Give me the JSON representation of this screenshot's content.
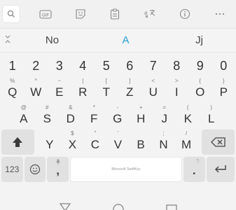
{
  "toolbar": {
    "items": [
      {
        "name": "search-icon"
      },
      {
        "name": "gif-icon",
        "label": "GIF"
      },
      {
        "name": "sticker-icon"
      },
      {
        "name": "clipboard-icon"
      },
      {
        "name": "translator-icon"
      },
      {
        "name": "info-icon"
      },
      {
        "name": "more-icon"
      }
    ]
  },
  "suggestions": {
    "collapse_icon": "chevrons-icon",
    "items": [
      "No",
      "A",
      "Jj"
    ]
  },
  "keyboard": {
    "numbers": [
      "1",
      "2",
      "3",
      "4",
      "5",
      "6",
      "7",
      "8",
      "9",
      "0"
    ],
    "row1": {
      "main": [
        "Q",
        "W",
        "E",
        "R",
        "T",
        "Z",
        "U",
        "I",
        "O",
        "P"
      ],
      "alt": [
        "%",
        "^",
        "~",
        "|",
        "[",
        "]",
        "<",
        ">",
        "{",
        "}"
      ]
    },
    "row2": {
      "main": [
        "A",
        "S",
        "D",
        "F",
        "G",
        "H",
        "J",
        "K",
        "L"
      ],
      "alt": [
        "@",
        "#",
        "&",
        "*",
        "-",
        "+",
        "=",
        "(",
        ")"
      ]
    },
    "row3": {
      "main": [
        "Y",
        "X",
        "C",
        "V",
        "B",
        "N",
        "M"
      ],
      "alt": [
        "",
        "$",
        "\"",
        "'",
        "",
        ";",
        "/"
      ]
    },
    "bottom": {
      "numbers_label": "123",
      "comma": ",",
      "space_label": "Microsoft SwiftKey",
      "period": "."
    }
  },
  "colors": {
    "accent": "#2a9fd6",
    "fn_key": "#e1e1e1",
    "background": "#f3f3f3"
  }
}
